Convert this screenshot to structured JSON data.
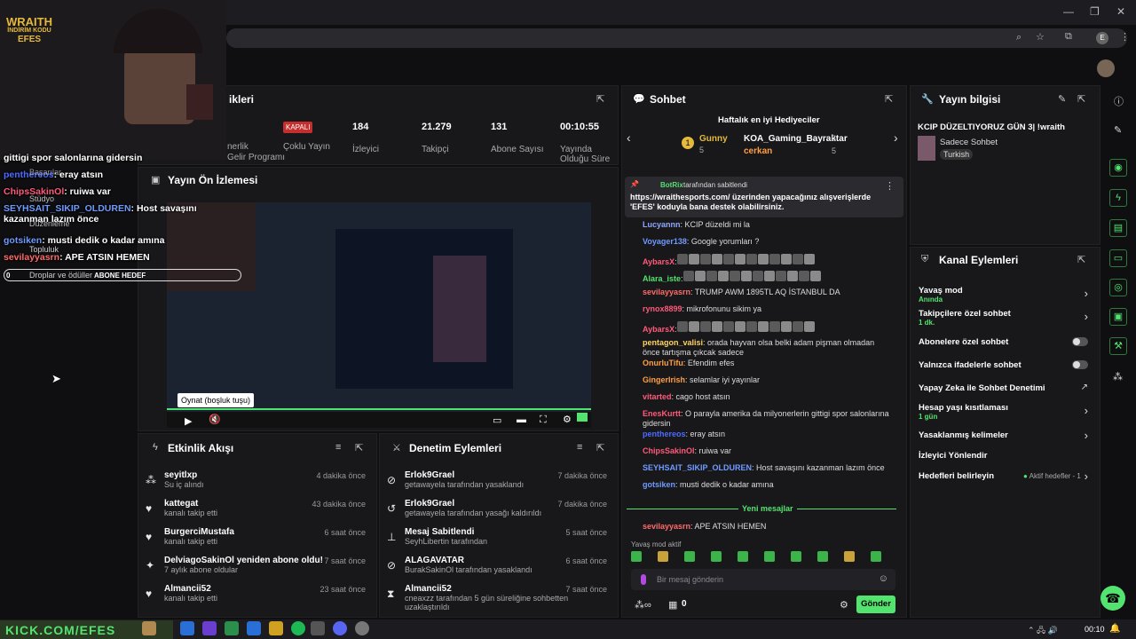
{
  "overlay": {
    "logo_line1": "WRAITH",
    "logo_line2": "İNDİRİM KODU",
    "logo_line3": "EFES",
    "chat": [
      {
        "user": "",
        "text": "gittigi spor salonlarına gidersin",
        "color": "#ffffff"
      },
      {
        "user": "penthereos",
        "text": ": eray atsın",
        "color": "#4d6bff"
      },
      {
        "user": "ChipsSakinOl",
        "text": ": ruiwa var",
        "color": "#ff5a7a"
      },
      {
        "user": "SEYHSAIT_SIKIP_OLDUREN",
        "text": ": Host savaşını kazanman lazım önce",
        "color": "#6f9bff"
      },
      {
        "user": "gotsiken",
        "text": ": musti dedik o kadar amına",
        "color": "#6f9bff"
      },
      {
        "user": "sevilayyasrn",
        "text": ": APE ATSIN HEMEN",
        "color": "#ff6b6b"
      }
    ],
    "menu": [
      "Başarılar",
      "Stüdyo",
      "Düzenleme",
      "Topluluk",
      "Droplar ve ödüller"
    ],
    "goal_count": "0",
    "goal_label": "ABONE HEDEF",
    "bottom_banner": "KICK.COM/EFES"
  },
  "stream_stats": {
    "title": "ikleri",
    "partner_sub": "nerlik\nGelir Programı",
    "kapali": "KAPALI",
    "kapali_label": "Çoklu Yayın",
    "stats": [
      {
        "value": "184",
        "label": "İzleyici"
      },
      {
        "value": "21.279",
        "label": "Takipçi"
      },
      {
        "value": "131",
        "label": "Abone Sayısı"
      },
      {
        "value": "00:10:55",
        "label": "Yayında Olduğu Süre"
      }
    ]
  },
  "preview": {
    "title": "Yayın Ön İzlemesi",
    "tooltip": "Oynat (boşluk tuşu)"
  },
  "activity": {
    "title": "Etkinlik Akışı",
    "items": [
      {
        "title": "seyitlxp",
        "sub": "Su iç alındı",
        "time": "4 dakika önce",
        "icon": "⁂"
      },
      {
        "title": "kattegat",
        "sub": "kanalı takip etti",
        "time": "43 dakika önce",
        "icon": "♥"
      },
      {
        "title": "BurgerciMustafa",
        "sub": "kanalı takip etti",
        "time": "6 saat önce",
        "icon": "♥"
      },
      {
        "title": "DelviagoSakinOl yeniden abone oldu!",
        "sub": "7 aylık abone oldular",
        "time": "7 saat önce",
        "icon": "✦"
      },
      {
        "title": "Almancii52",
        "sub": "kanalı takip etti",
        "time": "23 saat önce",
        "icon": "♥"
      }
    ]
  },
  "moderation": {
    "title": "Denetim Eylemleri",
    "items": [
      {
        "title": "Erlok9Grael",
        "sub": "getawayela tarafından yasaklandı",
        "time": "7 dakika önce",
        "icon": "⊘"
      },
      {
        "title": "Erlok9Grael",
        "sub": "getawayela tarafından yasağı kaldırıldı",
        "time": "7 dakika önce",
        "icon": "↺"
      },
      {
        "title": "Mesaj Sabitlendi",
        "sub": "SeyhLibertin tarafından",
        "time": "5 saat önce",
        "icon": "⊥"
      },
      {
        "title": "ALAGAVATAR",
        "sub": "BurakSakinOl tarafından yasaklandı",
        "time": "6 saat önce",
        "icon": "⊘"
      },
      {
        "title": "Almancii52",
        "sub": "cneaxzz tarafından 5 gün süreliğine sohbetten uzaklaştırıldı",
        "time": "7 saat önce",
        "icon": "⧗"
      }
    ]
  },
  "chat": {
    "title": "Sohbet",
    "gifters_title": "Haftalık en iyi Hediyeciler",
    "gifters": [
      {
        "name": "Gunny",
        "count": "5"
      },
      {
        "name": "KOA_Gaming_Bayraktar",
        "count": "5"
      },
      {
        "name": "cerkan",
        "count": "5"
      }
    ],
    "pinned_user": "BotRix",
    "pinned_by": "tarafından sabitlendi",
    "pinned_text": "https://wraithesports.com/ üzerinden yapacağınız alışverişlerde 'EFES' koduyla bana destek olabilirsiniz.",
    "messages": [
      {
        "user": "Lucyannn",
        "color": "#8fa8ff",
        "text": ": KCIP düzeldi mi la"
      },
      {
        "user": "Voyager138",
        "color": "#6f9bff",
        "text": ": Google yorumları ?"
      },
      {
        "user": "AybarsX",
        "color": "#ff5a7a",
        "text": ":"
      },
      {
        "user": "Alara_iste",
        "color": "#53e36f",
        "text": ":"
      },
      {
        "user": "sevilayyasrn",
        "color": "#ff6b6b",
        "text": ": TRUMP AWM 1895TL AQ İSTANBUL DA"
      },
      {
        "user": "rynox8899",
        "color": "#ff5a7a",
        "text": ": mikrofonunu sikim ya"
      },
      {
        "user": "AybarsX",
        "color": "#ff5a7a",
        "text": ":"
      },
      {
        "user": "pentagon_valisi",
        "color": "#ffd35c",
        "text": ": orada hayvan olsa belki adam pişman olmadan önce tartışma çıkcak sadece"
      },
      {
        "user": "OnurluTifu",
        "color": "#ff9f43",
        "text": ": Efendim efes"
      },
      {
        "user": "GingerIrish",
        "color": "#ff9f43",
        "text": ": selamlar iyi yayınlar"
      },
      {
        "user": "vitarted",
        "color": "#ff5a7a",
        "text": ": cago host atsın"
      },
      {
        "user": "EnesKurtt",
        "color": "#ff5a7a",
        "text": ": O parayla amerika da milyonerlerin gittigi spor salonlarına gidersin"
      },
      {
        "user": "penthereos",
        "color": "#4d6bff",
        "text": ": eray atsın"
      },
      {
        "user": "ChipsSakinOl",
        "color": "#ff5a7a",
        "text": ": ruiwa var"
      },
      {
        "user": "SEYHSAIT_SIKIP_OLDUREN",
        "color": "#6f9bff",
        "text": ": Host savaşını kazanman lazım önce"
      },
      {
        "user": "gotsiken",
        "color": "#6f9bff",
        "text": ": musti dedik o kadar amına"
      }
    ],
    "new_messages": "Yeni mesajlar",
    "last": {
      "user": "sevilayyasrn",
      "color": "#ff6b6b",
      "text": ": APE ATSIN HEMEN"
    },
    "slow_mode": "Yavaş mod aktif",
    "input_placeholder": "Bir mesaj gönderin",
    "send": "Gönder",
    "points": "0"
  },
  "stream_info": {
    "title": "Yayın bilgisi",
    "stream_title": "KCIP DÜZELTIYORUZ GÜN 3| !wraith",
    "category": "Sadece Sohbet",
    "language": "Turkish"
  },
  "channel_actions": {
    "title": "Kanal Eylemleri",
    "items": [
      {
        "label": "Yavaş mod",
        "sub": "Anında",
        "ctl": "arrow"
      },
      {
        "label": "Takipçilere özel sohbet",
        "sub": "1 dk.",
        "ctl": "arrow"
      },
      {
        "label": "Abonelere özel sohbet",
        "sub": "",
        "ctl": "toggle"
      },
      {
        "label": "Yalnızca ifadelerle sohbet",
        "sub": "",
        "ctl": "toggle"
      },
      {
        "label": "Yapay Zeka ile Sohbet Denetimi",
        "sub": "",
        "ctl": "ext"
      },
      {
        "label": "Hesap yaşı kısıtlaması",
        "sub": "1 gün",
        "ctl": "arrow"
      },
      {
        "label": "Yasaklanmış kelimeler",
        "sub": "",
        "ctl": "arrow"
      },
      {
        "label": "İzleyici Yönlendir",
        "sub": "",
        "ctl": "none"
      },
      {
        "label": "Hedefleri belirleyin",
        "sub": "",
        "ctl": "arrow",
        "extra": "Aktif hedefler - 1"
      }
    ]
  },
  "taskbar": {
    "time": "00:10"
  }
}
